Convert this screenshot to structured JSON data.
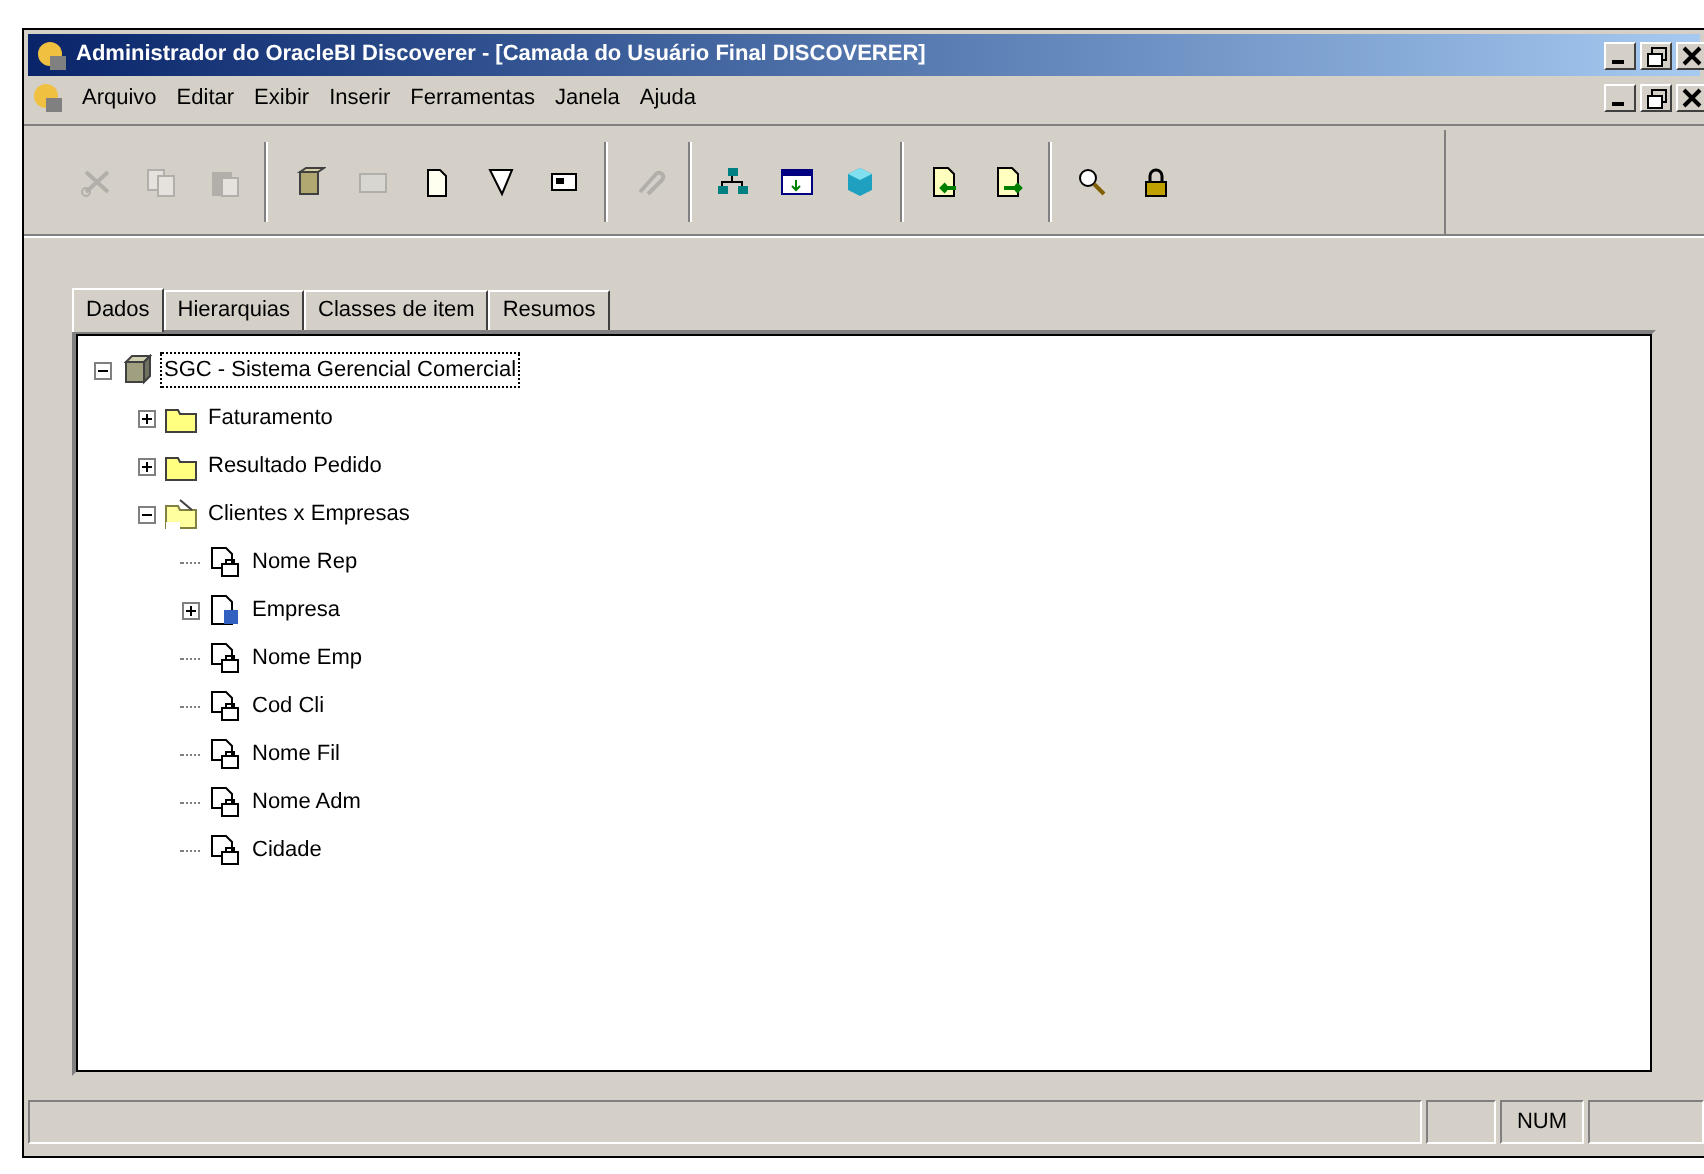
{
  "window": {
    "title": "Administrador do OracleBI Discoverer - [Camada do Usuário Final DISCOVERER]"
  },
  "menu": [
    "Arquivo",
    "Editar",
    "Exibir",
    "Inserir",
    "Ferramentas",
    "Janela",
    "Ajuda"
  ],
  "toolbar": [
    {
      "kind": "cut",
      "disabled": true
    },
    {
      "kind": "copy",
      "disabled": true
    },
    {
      "kind": "paste",
      "disabled": true
    },
    {
      "kind": "sep"
    },
    {
      "kind": "cube",
      "disabled": false
    },
    {
      "kind": "tray",
      "disabled": true
    },
    {
      "kind": "page",
      "disabled": false
    },
    {
      "kind": "filter",
      "disabled": false
    },
    {
      "kind": "calc",
      "disabled": false
    },
    {
      "kind": "sep"
    },
    {
      "kind": "link",
      "disabled": true
    },
    {
      "kind": "sep"
    },
    {
      "kind": "hierarchy",
      "disabled": false
    },
    {
      "kind": "window",
      "disabled": false
    },
    {
      "kind": "cube3d",
      "disabled": false
    },
    {
      "kind": "sep"
    },
    {
      "kind": "import",
      "disabled": false
    },
    {
      "kind": "export",
      "disabled": false
    },
    {
      "kind": "sep"
    },
    {
      "kind": "find",
      "disabled": false
    },
    {
      "kind": "lock",
      "disabled": false
    }
  ],
  "tabs": [
    {
      "label": "Dados",
      "selected": true
    },
    {
      "label": "Hierarquias",
      "selected": false
    },
    {
      "label": "Classes de item",
      "selected": false
    },
    {
      "label": "Resumos",
      "selected": false
    }
  ],
  "tree": [
    {
      "label": "SGC - Sistema Gerencial Comercial",
      "kind": "business-area",
      "selected": true,
      "expanded": true,
      "children": [
        {
          "label": "Faturamento",
          "kind": "folder",
          "selected": false,
          "expanded": false
        },
        {
          "label": "Resultado Pedido",
          "kind": "folder",
          "selected": false,
          "expanded": false
        },
        {
          "label": "Clientes x Empresas",
          "kind": "sql-folder",
          "selected": false,
          "expanded": true,
          "children": [
            {
              "label": "Nome Rep",
              "kind": "item",
              "selected": false
            },
            {
              "label": "Empresa",
              "kind": "hier-item",
              "selected": false,
              "expanded": false
            },
            {
              "label": "Nome Emp",
              "kind": "item",
              "selected": false
            },
            {
              "label": "Cod Cli",
              "kind": "item",
              "selected": false
            },
            {
              "label": "Nome Fil",
              "kind": "item",
              "selected": false
            },
            {
              "label": "Nome Adm",
              "kind": "item",
              "selected": false
            },
            {
              "label": "Cidade",
              "kind": "item",
              "selected": false
            }
          ]
        }
      ]
    }
  ],
  "status_bar": {
    "indicator": "NUM"
  }
}
